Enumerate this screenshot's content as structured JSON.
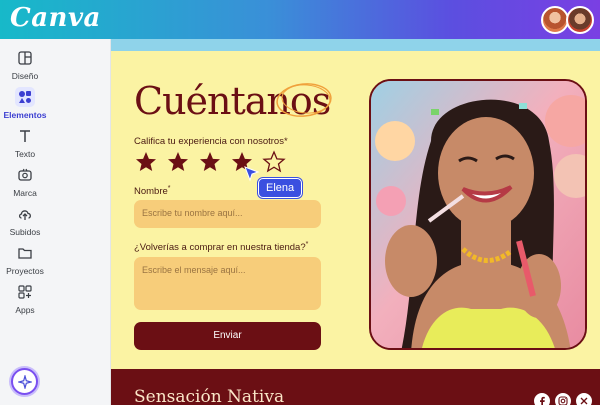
{
  "app": {
    "logo": "Canva"
  },
  "sidebar": {
    "items": [
      {
        "label": "Diseño"
      },
      {
        "label": "Elementos"
      },
      {
        "label": "Texto"
      },
      {
        "label": "Marca"
      },
      {
        "label": "Subidos"
      },
      {
        "label": "Proyectos"
      },
      {
        "label": "Apps"
      }
    ]
  },
  "design": {
    "heading": "Cuéntanos",
    "rating_label": "Califica tu experiencia con nosotros*",
    "rating": {
      "value": 4,
      "max": 5,
      "filled_color": "#6b0f14"
    },
    "cursor_user": "Elena",
    "name_label": "Nombre",
    "name_required": "*",
    "name_placeholder": "Escribe tu nombre aquí...",
    "question_label": "¿Volverías a comprar en nuestra tienda?",
    "question_required": "*",
    "message_placeholder": "Escribe el mensaje aquí...",
    "submit_label": "Enviar",
    "brand": "Sensación Nativa"
  },
  "colors": {
    "accent": "#6b0f14",
    "background": "#fbf3a3",
    "input": "#f7cd7a",
    "cursor_tag": "#3a4fe0"
  }
}
